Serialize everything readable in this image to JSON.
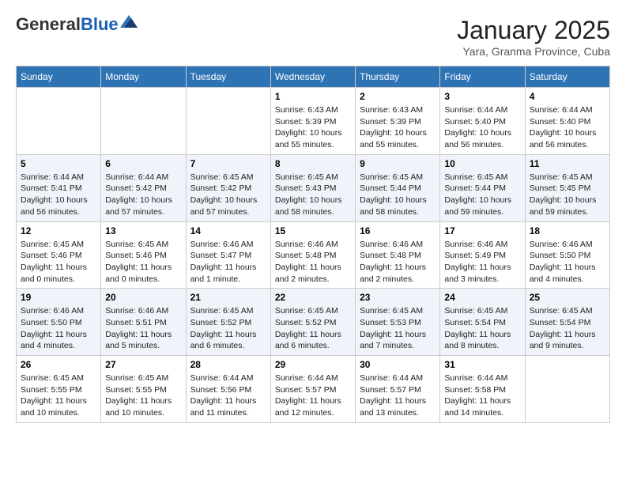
{
  "header": {
    "logo_general": "General",
    "logo_blue": "Blue",
    "month": "January 2025",
    "location": "Yara, Granma Province, Cuba"
  },
  "weekdays": [
    "Sunday",
    "Monday",
    "Tuesday",
    "Wednesday",
    "Thursday",
    "Friday",
    "Saturday"
  ],
  "rows": [
    [
      {
        "day": "",
        "sunrise": "",
        "sunset": "",
        "daylight": ""
      },
      {
        "day": "",
        "sunrise": "",
        "sunset": "",
        "daylight": ""
      },
      {
        "day": "",
        "sunrise": "",
        "sunset": "",
        "daylight": ""
      },
      {
        "day": "1",
        "sunrise": "Sunrise: 6:43 AM",
        "sunset": "Sunset: 5:39 PM",
        "daylight": "Daylight: 10 hours and 55 minutes."
      },
      {
        "day": "2",
        "sunrise": "Sunrise: 6:43 AM",
        "sunset": "Sunset: 5:39 PM",
        "daylight": "Daylight: 10 hours and 55 minutes."
      },
      {
        "day": "3",
        "sunrise": "Sunrise: 6:44 AM",
        "sunset": "Sunset: 5:40 PM",
        "daylight": "Daylight: 10 hours and 56 minutes."
      },
      {
        "day": "4",
        "sunrise": "Sunrise: 6:44 AM",
        "sunset": "Sunset: 5:40 PM",
        "daylight": "Daylight: 10 hours and 56 minutes."
      }
    ],
    [
      {
        "day": "5",
        "sunrise": "Sunrise: 6:44 AM",
        "sunset": "Sunset: 5:41 PM",
        "daylight": "Daylight: 10 hours and 56 minutes."
      },
      {
        "day": "6",
        "sunrise": "Sunrise: 6:44 AM",
        "sunset": "Sunset: 5:42 PM",
        "daylight": "Daylight: 10 hours and 57 minutes."
      },
      {
        "day": "7",
        "sunrise": "Sunrise: 6:45 AM",
        "sunset": "Sunset: 5:42 PM",
        "daylight": "Daylight: 10 hours and 57 minutes."
      },
      {
        "day": "8",
        "sunrise": "Sunrise: 6:45 AM",
        "sunset": "Sunset: 5:43 PM",
        "daylight": "Daylight: 10 hours and 58 minutes."
      },
      {
        "day": "9",
        "sunrise": "Sunrise: 6:45 AM",
        "sunset": "Sunset: 5:44 PM",
        "daylight": "Daylight: 10 hours and 58 minutes."
      },
      {
        "day": "10",
        "sunrise": "Sunrise: 6:45 AM",
        "sunset": "Sunset: 5:44 PM",
        "daylight": "Daylight: 10 hours and 59 minutes."
      },
      {
        "day": "11",
        "sunrise": "Sunrise: 6:45 AM",
        "sunset": "Sunset: 5:45 PM",
        "daylight": "Daylight: 10 hours and 59 minutes."
      }
    ],
    [
      {
        "day": "12",
        "sunrise": "Sunrise: 6:45 AM",
        "sunset": "Sunset: 5:46 PM",
        "daylight": "Daylight: 11 hours and 0 minutes."
      },
      {
        "day": "13",
        "sunrise": "Sunrise: 6:45 AM",
        "sunset": "Sunset: 5:46 PM",
        "daylight": "Daylight: 11 hours and 0 minutes."
      },
      {
        "day": "14",
        "sunrise": "Sunrise: 6:46 AM",
        "sunset": "Sunset: 5:47 PM",
        "daylight": "Daylight: 11 hours and 1 minute."
      },
      {
        "day": "15",
        "sunrise": "Sunrise: 6:46 AM",
        "sunset": "Sunset: 5:48 PM",
        "daylight": "Daylight: 11 hours and 2 minutes."
      },
      {
        "day": "16",
        "sunrise": "Sunrise: 6:46 AM",
        "sunset": "Sunset: 5:48 PM",
        "daylight": "Daylight: 11 hours and 2 minutes."
      },
      {
        "day": "17",
        "sunrise": "Sunrise: 6:46 AM",
        "sunset": "Sunset: 5:49 PM",
        "daylight": "Daylight: 11 hours and 3 minutes."
      },
      {
        "day": "18",
        "sunrise": "Sunrise: 6:46 AM",
        "sunset": "Sunset: 5:50 PM",
        "daylight": "Daylight: 11 hours and 4 minutes."
      }
    ],
    [
      {
        "day": "19",
        "sunrise": "Sunrise: 6:46 AM",
        "sunset": "Sunset: 5:50 PM",
        "daylight": "Daylight: 11 hours and 4 minutes."
      },
      {
        "day": "20",
        "sunrise": "Sunrise: 6:46 AM",
        "sunset": "Sunset: 5:51 PM",
        "daylight": "Daylight: 11 hours and 5 minutes."
      },
      {
        "day": "21",
        "sunrise": "Sunrise: 6:45 AM",
        "sunset": "Sunset: 5:52 PM",
        "daylight": "Daylight: 11 hours and 6 minutes."
      },
      {
        "day": "22",
        "sunrise": "Sunrise: 6:45 AM",
        "sunset": "Sunset: 5:52 PM",
        "daylight": "Daylight: 11 hours and 6 minutes."
      },
      {
        "day": "23",
        "sunrise": "Sunrise: 6:45 AM",
        "sunset": "Sunset: 5:53 PM",
        "daylight": "Daylight: 11 hours and 7 minutes."
      },
      {
        "day": "24",
        "sunrise": "Sunrise: 6:45 AM",
        "sunset": "Sunset: 5:54 PM",
        "daylight": "Daylight: 11 hours and 8 minutes."
      },
      {
        "day": "25",
        "sunrise": "Sunrise: 6:45 AM",
        "sunset": "Sunset: 5:54 PM",
        "daylight": "Daylight: 11 hours and 9 minutes."
      }
    ],
    [
      {
        "day": "26",
        "sunrise": "Sunrise: 6:45 AM",
        "sunset": "Sunset: 5:55 PM",
        "daylight": "Daylight: 11 hours and 10 minutes."
      },
      {
        "day": "27",
        "sunrise": "Sunrise: 6:45 AM",
        "sunset": "Sunset: 5:55 PM",
        "daylight": "Daylight: 11 hours and 10 minutes."
      },
      {
        "day": "28",
        "sunrise": "Sunrise: 6:44 AM",
        "sunset": "Sunset: 5:56 PM",
        "daylight": "Daylight: 11 hours and 11 minutes."
      },
      {
        "day": "29",
        "sunrise": "Sunrise: 6:44 AM",
        "sunset": "Sunset: 5:57 PM",
        "daylight": "Daylight: 11 hours and 12 minutes."
      },
      {
        "day": "30",
        "sunrise": "Sunrise: 6:44 AM",
        "sunset": "Sunset: 5:57 PM",
        "daylight": "Daylight: 11 hours and 13 minutes."
      },
      {
        "day": "31",
        "sunrise": "Sunrise: 6:44 AM",
        "sunset": "Sunset: 5:58 PM",
        "daylight": "Daylight: 11 hours and 14 minutes."
      },
      {
        "day": "",
        "sunrise": "",
        "sunset": "",
        "daylight": ""
      }
    ]
  ]
}
